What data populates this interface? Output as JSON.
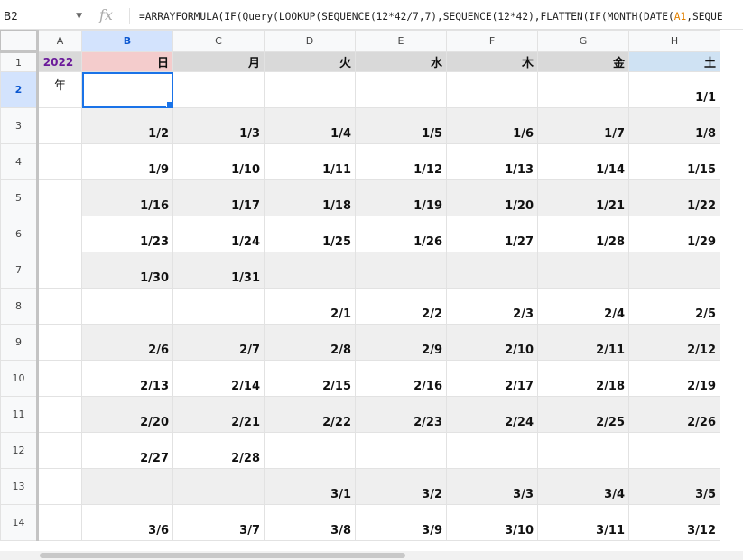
{
  "name_box": "B2",
  "fx_label": "fx",
  "formula": {
    "part1": "=ARRAYFORMULA(IF(Query(LOOKUP(SEQUENCE(12*42/7,7),SEQUENCE(12*42),FLATTEN(IF(MONTH(DATE(",
    "ref": "A1",
    "part2": ",SEQUE"
  },
  "columns": [
    "A",
    "B",
    "C",
    "D",
    "E",
    "F",
    "G",
    "H"
  ],
  "selected_col": "B",
  "selected_row": "2",
  "header_row": {
    "row_num": "1",
    "year": "2022",
    "days": [
      "日",
      "月",
      "火",
      "水",
      "木",
      "金",
      "土"
    ]
  },
  "year_suffix": "年",
  "rows": [
    {
      "num": "2",
      "cells": [
        "",
        "",
        "",
        "",
        "",
        "",
        "1/1"
      ]
    },
    {
      "num": "3",
      "cells": [
        "1/2",
        "1/3",
        "1/4",
        "1/5",
        "1/6",
        "1/7",
        "1/8"
      ]
    },
    {
      "num": "4",
      "cells": [
        "1/9",
        "1/10",
        "1/11",
        "1/12",
        "1/13",
        "1/14",
        "1/15"
      ]
    },
    {
      "num": "5",
      "cells": [
        "1/16",
        "1/17",
        "1/18",
        "1/19",
        "1/20",
        "1/21",
        "1/22"
      ]
    },
    {
      "num": "6",
      "cells": [
        "1/23",
        "1/24",
        "1/25",
        "1/26",
        "1/27",
        "1/28",
        "1/29"
      ]
    },
    {
      "num": "7",
      "cells": [
        "1/30",
        "1/31",
        "",
        "",
        "",
        "",
        ""
      ]
    },
    {
      "num": "8",
      "cells": [
        "",
        "",
        "2/1",
        "2/2",
        "2/3",
        "2/4",
        "2/5"
      ]
    },
    {
      "num": "9",
      "cells": [
        "2/6",
        "2/7",
        "2/8",
        "2/9",
        "2/10",
        "2/11",
        "2/12"
      ]
    },
    {
      "num": "10",
      "cells": [
        "2/13",
        "2/14",
        "2/15",
        "2/16",
        "2/17",
        "2/18",
        "2/19"
      ]
    },
    {
      "num": "11",
      "cells": [
        "2/20",
        "2/21",
        "2/22",
        "2/23",
        "2/24",
        "2/25",
        "2/26"
      ]
    },
    {
      "num": "12",
      "cells": [
        "2/27",
        "2/28",
        "",
        "",
        "",
        "",
        ""
      ]
    },
    {
      "num": "13",
      "cells": [
        "",
        "",
        "3/1",
        "3/2",
        "3/3",
        "3/4",
        "3/5"
      ]
    },
    {
      "num": "14",
      "cells": [
        "3/6",
        "3/7",
        "3/8",
        "3/9",
        "3/10",
        "3/11",
        "3/12"
      ]
    }
  ]
}
